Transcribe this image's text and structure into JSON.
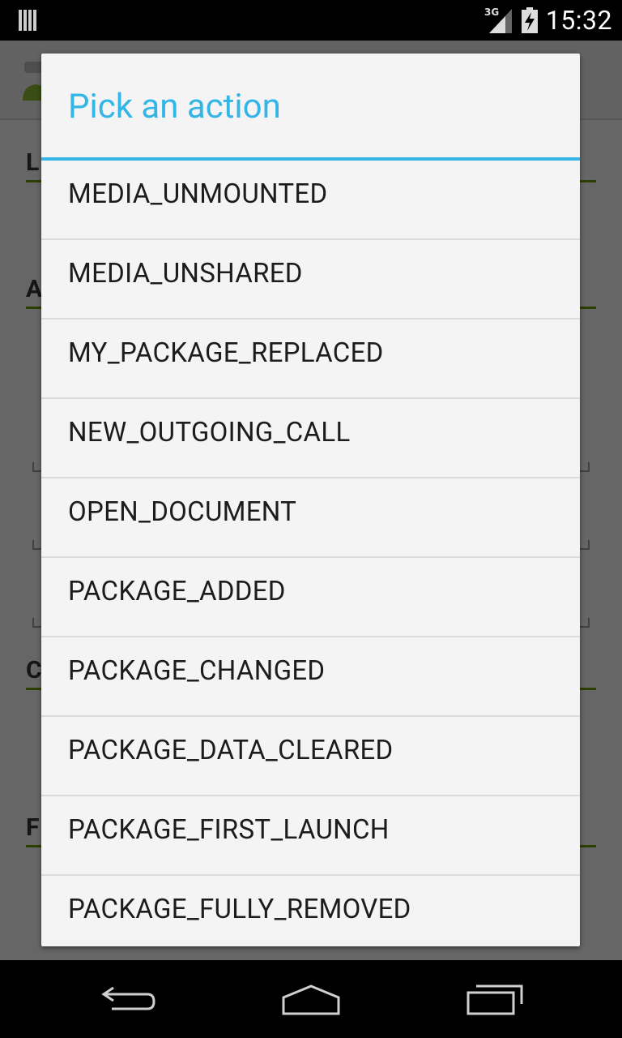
{
  "status_bar": {
    "time": "15:32",
    "network_type": "3G",
    "icons": [
      "notification-icon",
      "signal-icon",
      "battery-charging-icon"
    ]
  },
  "background_app": {
    "section_letters": [
      "L",
      "A",
      "C",
      "F"
    ],
    "accent_color": "#669900"
  },
  "dialog": {
    "title": "Pick an action",
    "accent_color": "#33b5e5",
    "items": [
      {
        "label": "MEDIA_UNMOUNTED"
      },
      {
        "label": "MEDIA_UNSHARED"
      },
      {
        "label": "MY_PACKAGE_REPLACED"
      },
      {
        "label": "NEW_OUTGOING_CALL"
      },
      {
        "label": "OPEN_DOCUMENT"
      },
      {
        "label": "PACKAGE_ADDED"
      },
      {
        "label": "PACKAGE_CHANGED"
      },
      {
        "label": "PACKAGE_DATA_CLEARED"
      },
      {
        "label": "PACKAGE_FIRST_LAUNCH"
      },
      {
        "label": "PACKAGE_FULLY_REMOVED"
      }
    ]
  },
  "nav_bar": {
    "buttons": [
      "back-icon",
      "home-icon",
      "recents-icon"
    ]
  }
}
